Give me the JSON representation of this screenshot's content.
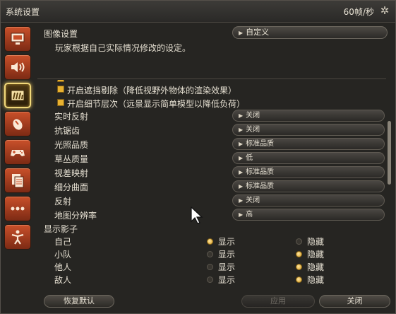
{
  "window": {
    "title": "系统设置",
    "fps": "60帧/秒",
    "settings_icon": "gear-icon"
  },
  "sidebar": {
    "items": [
      {
        "name": "display",
        "icon": "monitor-icon"
      },
      {
        "name": "sound",
        "icon": "speaker-icon"
      },
      {
        "name": "graphics",
        "icon": "graphics-icon",
        "active": true
      },
      {
        "name": "mouse",
        "icon": "mouse-icon"
      },
      {
        "name": "gamepad",
        "icon": "gamepad-icon"
      },
      {
        "name": "log",
        "icon": "document-icon"
      },
      {
        "name": "other",
        "icon": "more-icon"
      },
      {
        "name": "accessibility",
        "icon": "person-icon"
      }
    ]
  },
  "header": {
    "label": "图像设置",
    "preset": "自定义",
    "description": "玩家根据自己实际情况修改的设定。"
  },
  "checks": [
    {
      "label": "开启遮挡剔除（降低视野外物体的渲染效果）"
    },
    {
      "label": "开启细节层次（远景显示简单模型以降低负荷）"
    }
  ],
  "settings": [
    {
      "label": "实时反射",
      "value": "关闭"
    },
    {
      "label": "抗锯齿",
      "value": "关闭"
    },
    {
      "label": "光照品质",
      "value": "标准品质"
    },
    {
      "label": "草丛质量",
      "value": "低"
    },
    {
      "label": "视差映射",
      "value": "标准品质"
    },
    {
      "label": "细分曲面",
      "value": "标准品质"
    },
    {
      "label": "反射",
      "value": "关闭"
    },
    {
      "label": "地图分辨率",
      "value": "高"
    }
  ],
  "shadows": {
    "title": "显示影子",
    "show_label": "显示",
    "hide_label": "隐藏",
    "rows": [
      {
        "label": "自己",
        "selected": "show"
      },
      {
        "label": "小队",
        "selected": "hide"
      },
      {
        "label": "他人",
        "selected": "hide"
      },
      {
        "label": "敌人",
        "selected": "hide"
      }
    ]
  },
  "footer": {
    "reset": "恢复默认",
    "apply": "应用",
    "close": "关闭"
  }
}
